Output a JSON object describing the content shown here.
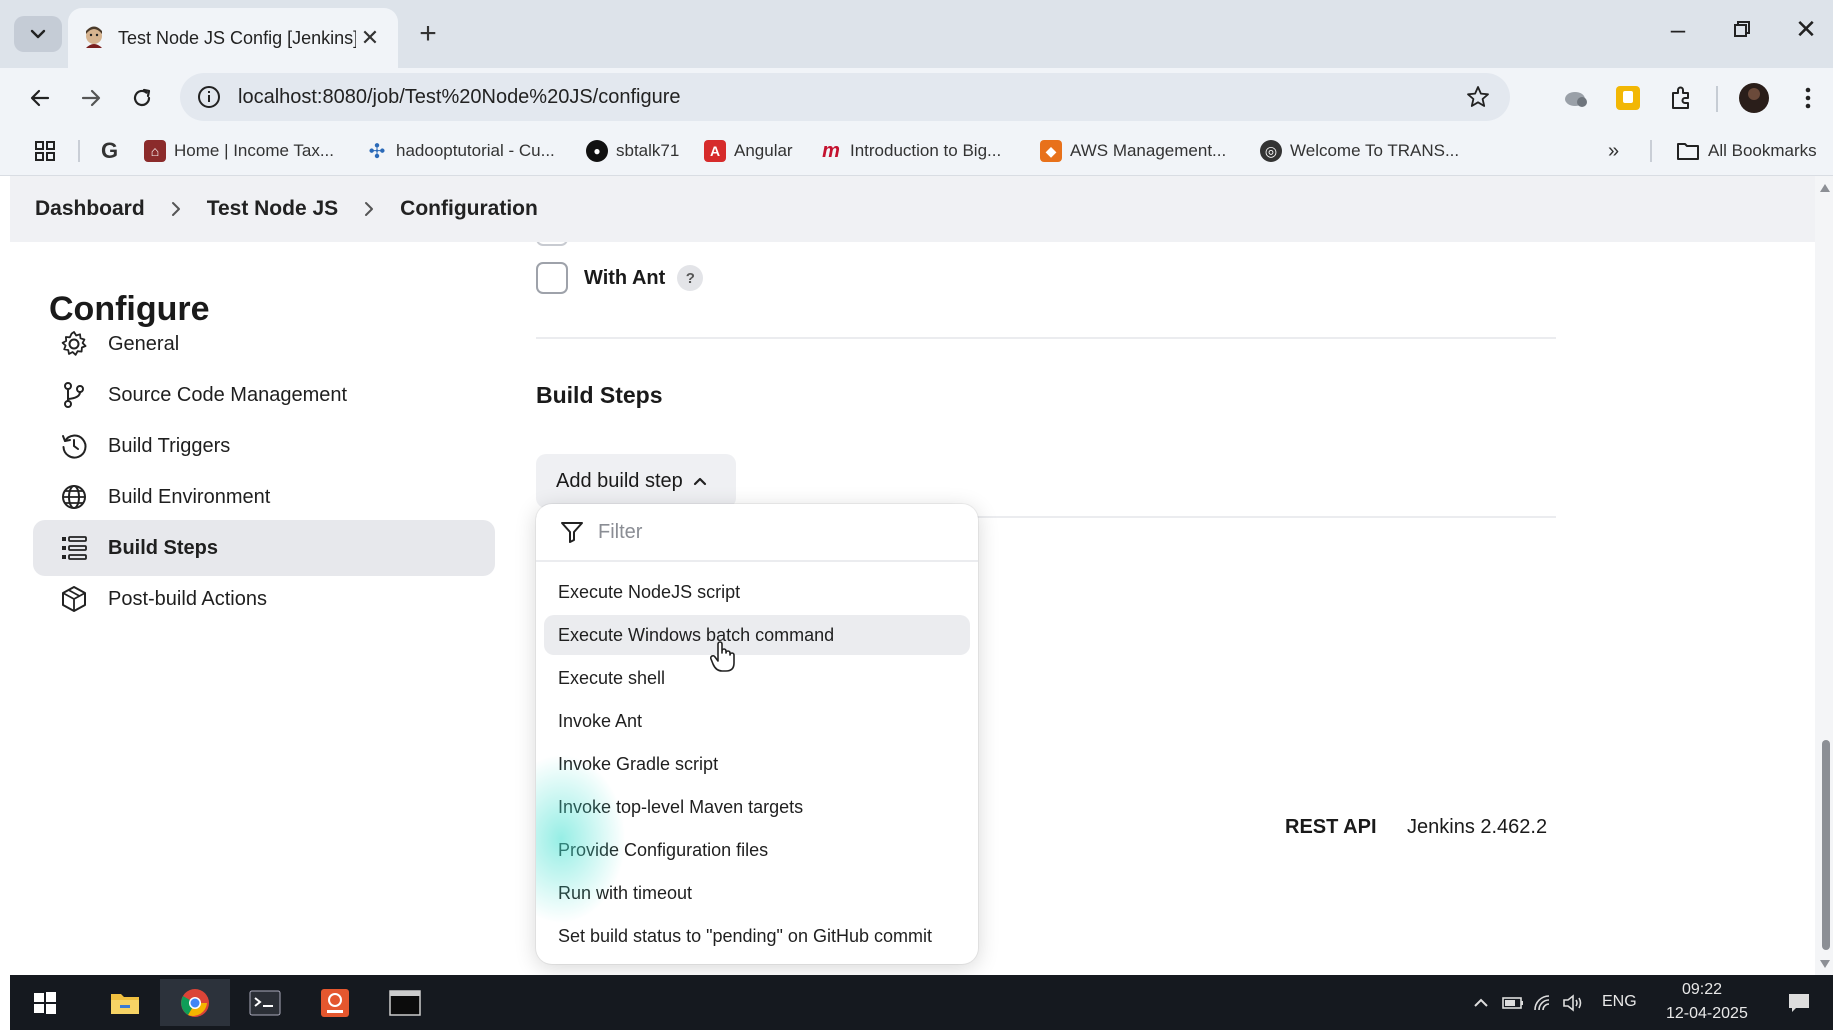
{
  "browser": {
    "tab_title": "Test Node JS Config [Jenkins]",
    "url": "localhost:8080/job/Test%20Node%20JS/configure",
    "bookmarks": [
      {
        "label": "Home | Income Tax...",
        "icon": "income-tax-icon",
        "color": "#8b2b2b"
      },
      {
        "label": "hadooptutorial - Cu...",
        "icon": "pinwheel-icon",
        "color": "#2b6ab8"
      },
      {
        "label": "sbtalk71",
        "icon": "github-icon",
        "color": "#111111"
      },
      {
        "label": "Angular",
        "icon": "angular-icon",
        "color": "#d62b2b"
      },
      {
        "label": "Introduction to Big...",
        "icon": "m-logo-icon",
        "color": "#c4122f"
      },
      {
        "label": "AWS Management...",
        "icon": "aws-cube-icon",
        "color": "#e8711a"
      },
      {
        "label": "Welcome To TRANS...",
        "icon": "globe-icon",
        "color": "#333333"
      }
    ],
    "all_bookmarks_label": "All Bookmarks"
  },
  "breadcrumb": {
    "items": [
      "Dashboard",
      "Test Node JS",
      "Configuration"
    ]
  },
  "sidebar": {
    "title": "Configure",
    "items": [
      {
        "label": "General",
        "icon": "gear-icon"
      },
      {
        "label": "Source Code Management",
        "icon": "git-branch-icon"
      },
      {
        "label": "Build Triggers",
        "icon": "clock-icon"
      },
      {
        "label": "Build Environment",
        "icon": "globe-icon"
      },
      {
        "label": "Build Steps",
        "icon": "list-icon",
        "active": true
      },
      {
        "label": "Post-build Actions",
        "icon": "package-icon"
      }
    ]
  },
  "main": {
    "with_ant_label": "With Ant",
    "help_label": "?",
    "section_title": "Build Steps",
    "add_build_step_label": "Add build step",
    "dropdown": {
      "filter_placeholder": "Filter",
      "items": [
        "Execute NodeJS script",
        "Execute Windows batch command",
        "Execute shell",
        "Invoke Ant",
        "Invoke Gradle script",
        "Invoke top-level Maven targets",
        "Provide Configuration files",
        "Run with timeout",
        "Set build status to \"pending\" on GitHub commit"
      ],
      "hovered_index": 1
    }
  },
  "footer": {
    "rest_api": "REST API",
    "version": "Jenkins 2.462.2"
  },
  "taskbar": {
    "language": "ENG",
    "time": "09:22",
    "date": "12-04-2025"
  },
  "colors": {
    "active_sidebar_bg": "#e7e8ec",
    "taskbar_bg": "#15191f",
    "chrome_bg": "#dde3ea"
  }
}
